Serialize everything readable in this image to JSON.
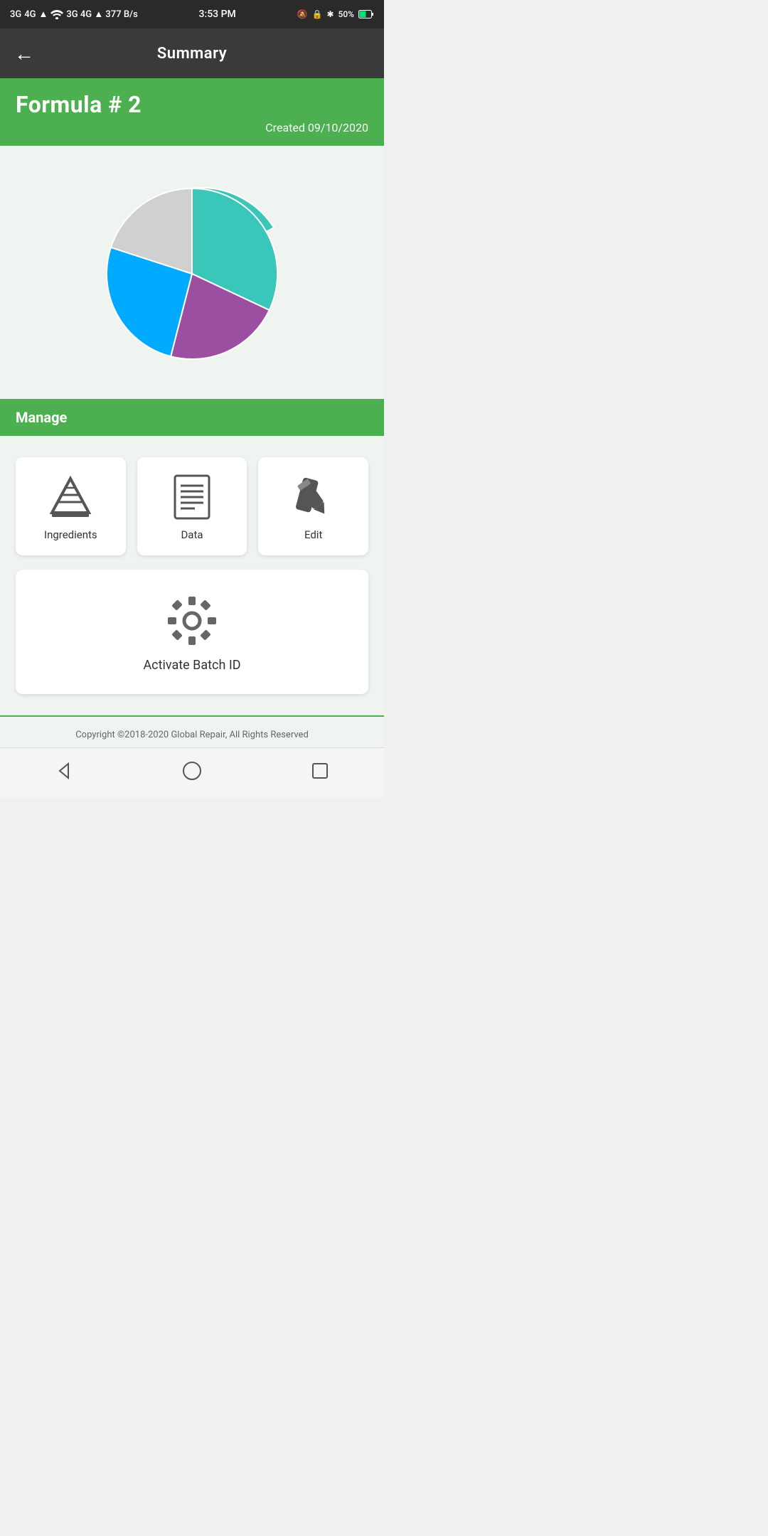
{
  "status_bar": {
    "left": "3G 4G ▲ 377 B/s",
    "time": "3:53 PM",
    "right": "50%"
  },
  "header": {
    "title": "Summary",
    "back_label": "←"
  },
  "formula": {
    "title": "Formula # 2",
    "created": "Created 09/10/2020"
  },
  "chart": {
    "segments": [
      {
        "color": "#3ac6b8",
        "label": "Teal",
        "percent": 32
      },
      {
        "color": "#9b4fa0",
        "label": "Purple",
        "percent": 22
      },
      {
        "color": "#00aaff",
        "label": "Blue",
        "percent": 26
      },
      {
        "color": "#d8d8d8",
        "label": "Gray",
        "percent": 20
      }
    ]
  },
  "manage": {
    "title": "Manage"
  },
  "actions": [
    {
      "id": "ingredients",
      "label": "Ingredients",
      "icon": "pyramid-icon"
    },
    {
      "id": "data",
      "label": "Data",
      "icon": "document-icon"
    },
    {
      "id": "edit",
      "label": "Edit",
      "icon": "pencil-icon"
    }
  ],
  "batch": {
    "label": "Activate Batch ID",
    "icon": "gear-icon"
  },
  "footer": {
    "copyright": "Copyright ©2018-2020 Global Repair, All Rights Reserved"
  },
  "nav": {
    "back_label": "◁",
    "home_label": "○",
    "recent_label": "□"
  }
}
